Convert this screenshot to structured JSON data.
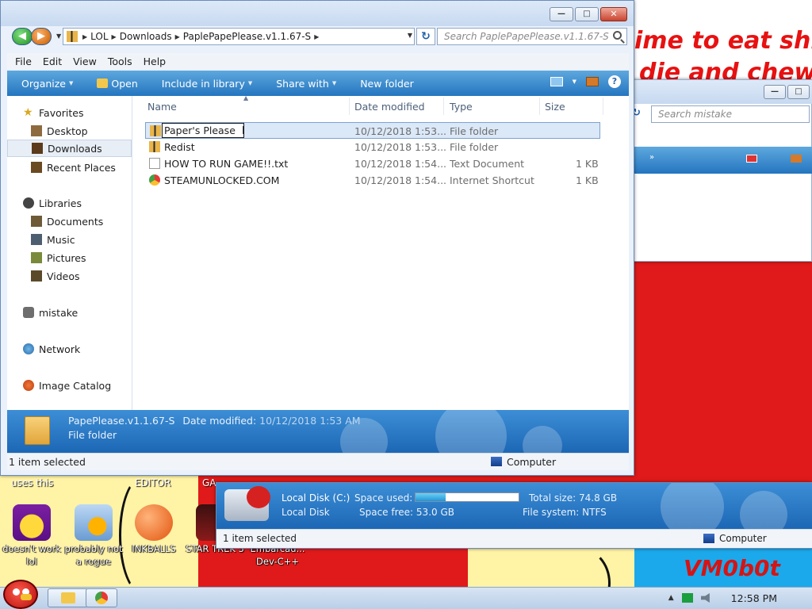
{
  "wallpaper": {
    "line1": "ime to eat shit",
    "line2": "die and chew",
    "watermark": "VM0b0t",
    "top_labels": [
      "uses this",
      "EDITOR",
      "GA"
    ]
  },
  "desktop_icons": [
    {
      "label": "doesn't work lol",
      "icon": "yahoo-messenger-icon"
    },
    {
      "label": "probably not a rogue",
      "icon": "system-gears-icon"
    },
    {
      "label": "INKBALLS",
      "icon": "inkball-icon"
    },
    {
      "label": "STAR TREK 3",
      "icon": "star-trek-icon"
    },
    {
      "label": "Embarcad... Dev-C++",
      "icon": "dev-cpp-icon"
    }
  ],
  "explorer": {
    "window_controls": {
      "minimize": "—",
      "maximize": "□",
      "close": "✕"
    },
    "breadcrumbs": [
      "LOL",
      "Downloads",
      "PaplePapePlease.v1.1.67-S"
    ],
    "search_placeholder": "Search PaplePapePlease.v1.1.67-S",
    "menu": [
      "File",
      "Edit",
      "View",
      "Tools",
      "Help"
    ],
    "commands": [
      {
        "label": "Organize",
        "dropdown": true
      },
      {
        "label": "Open",
        "dropdown": false
      },
      {
        "label": "Include in library",
        "dropdown": true
      },
      {
        "label": "Share with",
        "dropdown": true
      },
      {
        "label": "New folder",
        "dropdown": false
      }
    ],
    "help_glyph": "?",
    "nav": {
      "favorites": "Favorites",
      "desktop": "Desktop",
      "downloads": "Downloads",
      "recent": "Recent Places",
      "libraries": "Libraries",
      "documents": "Documents",
      "music": "Music",
      "pictures": "Pictures",
      "videos": "Videos",
      "mistake": "mistake",
      "network": "Network",
      "image_catalog": "Image Catalog"
    },
    "columns": {
      "name": "Name",
      "date": "Date modified",
      "type": "Type",
      "size": "Size"
    },
    "files": [
      {
        "name": "Paper's Please",
        "date": "10/12/2018 1:53...",
        "type": "File folder",
        "size": "",
        "icon": "folder-icon",
        "selected": true,
        "renaming": true
      },
      {
        "name": "Redist",
        "date": "10/12/2018 1:53...",
        "type": "File folder",
        "size": "",
        "icon": "folder-icon"
      },
      {
        "name": "HOW TO RUN GAME!!.txt",
        "date": "10/12/2018 1:54...",
        "type": "Text Document",
        "size": "1 KB",
        "icon": "text-file-icon"
      },
      {
        "name": "STEAMUNLOCKED.COM",
        "date": "10/12/2018 1:54...",
        "type": "Internet Shortcut",
        "size": "1 KB",
        "icon": "chrome-shortcut-icon"
      }
    ],
    "details": {
      "name": "PapePlease.v1.1.67-S",
      "date_label": "Date modified:",
      "date_value": "10/12/2018 1:53 AM",
      "type": "File folder"
    },
    "status": {
      "left": "1 item selected",
      "right": "Computer"
    }
  },
  "back_window": {
    "search_placeholder": "Search mistake"
  },
  "disk_window": {
    "name": "Local Disk (C:)",
    "subtitle": "Local Disk",
    "space_used_label": "Space used:",
    "space_used_fraction": 0.29,
    "space_free_label": "Space free:",
    "space_free_value": "53.0 GB",
    "total_size_label": "Total size:",
    "total_size_value": "74.8 GB",
    "fs_label": "File system:",
    "fs_value": "NTFS",
    "status_left": "1 item selected",
    "status_right": "Computer"
  },
  "taskbar": {
    "clock": "12:58 PM",
    "tray_arrow": "▲"
  },
  "colors": {
    "command_bar": "#2475c0",
    "wallpaper_red": "#e01a1a",
    "selection": "#dbe8f8"
  }
}
